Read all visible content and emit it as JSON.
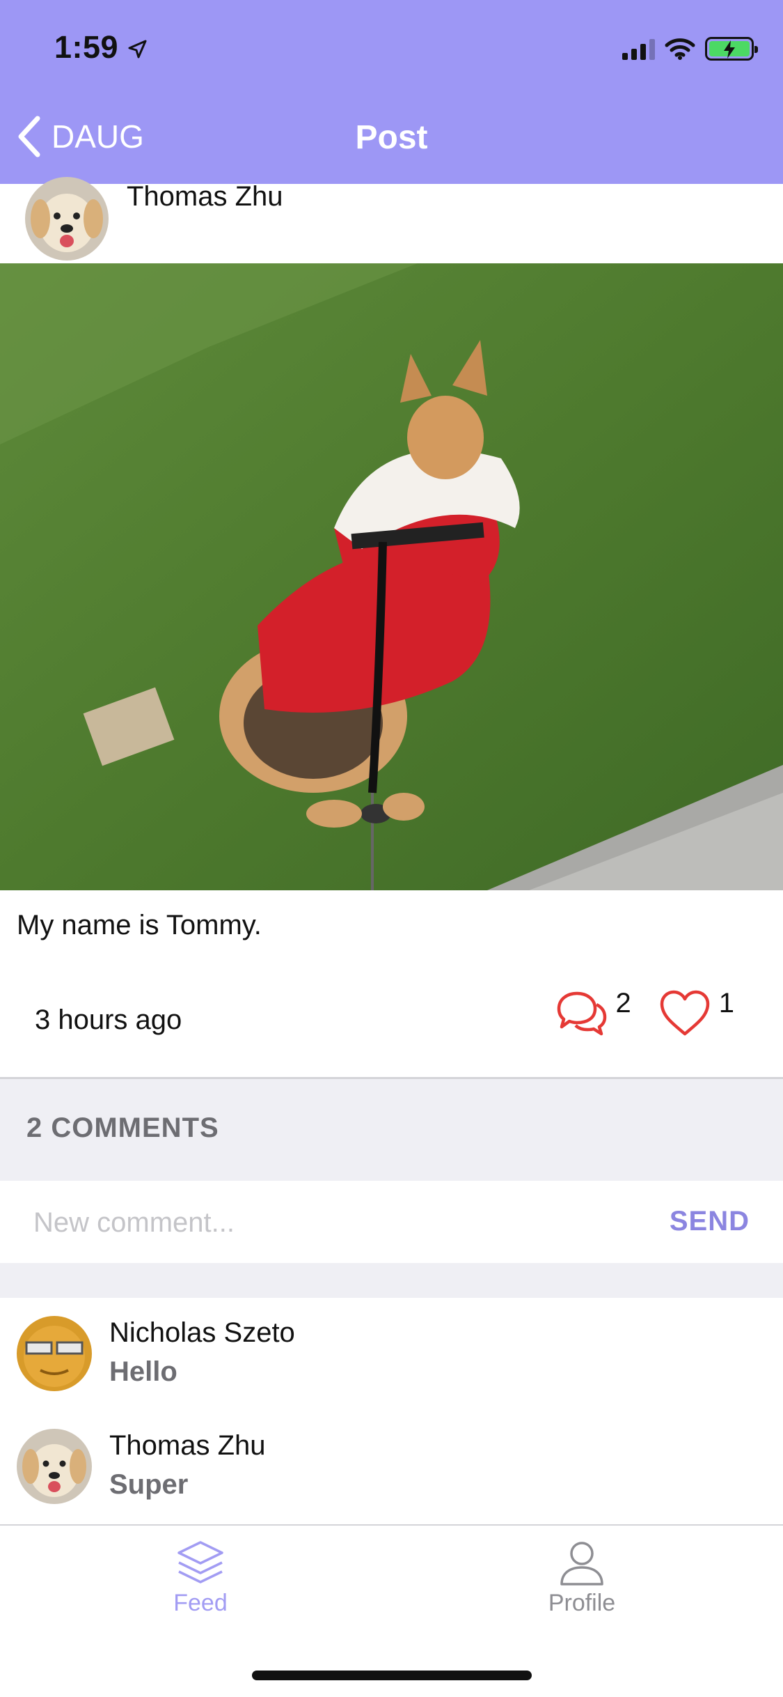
{
  "status_bar": {
    "time": "1:59"
  },
  "nav": {
    "back_label": "DAUG",
    "title": "Post"
  },
  "post": {
    "author": "Thomas Zhu",
    "caption": "My name is Tommy.",
    "time_ago": "3 hours ago",
    "comment_count": "2",
    "like_count": "1"
  },
  "comments_section": {
    "header": "2 COMMENTS",
    "input_placeholder": "New comment...",
    "send_label": "SEND",
    "items": [
      {
        "author": "Nicholas Szeto",
        "text": "Hello"
      },
      {
        "author": "Thomas Zhu",
        "text": "Super"
      }
    ]
  },
  "tabbar": {
    "tabs": [
      {
        "label": "Feed",
        "icon": "layers-icon",
        "active": true
      },
      {
        "label": "Profile",
        "icon": "person-icon",
        "active": false
      }
    ]
  },
  "colors": {
    "header": "#9d97f5",
    "accent": "#a29cf3",
    "heart": "#e53935",
    "section_bg": "#efeff4"
  }
}
